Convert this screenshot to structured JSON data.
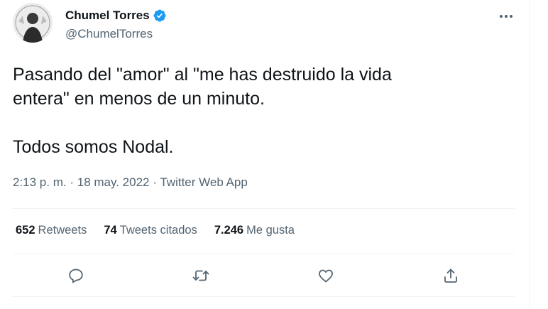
{
  "tweet": {
    "display_name": "Chumel Torres",
    "handle": "@ChumelTorres",
    "verified": true,
    "text": "Pasando del \"amor\" al \"me has destruido la vida\nentera\" en menos de un minuto.\n\nTodos somos Nodal.",
    "time": "2:13 p. m.",
    "separator": "·",
    "date": "18 may. 2022",
    "source": "Twitter Web App"
  },
  "stats": [
    {
      "count": "652",
      "label": "Retweets"
    },
    {
      "count": "74",
      "label": "Tweets citados"
    },
    {
      "count": "7.246",
      "label": "Me gusta"
    }
  ],
  "actions": [
    "reply-icon",
    "retweet-icon",
    "like-icon",
    "share-icon"
  ],
  "colors": {
    "text": "#0f1419",
    "secondary": "#536471",
    "verified": "#1d9bf0",
    "divider": "#eff3f4"
  }
}
